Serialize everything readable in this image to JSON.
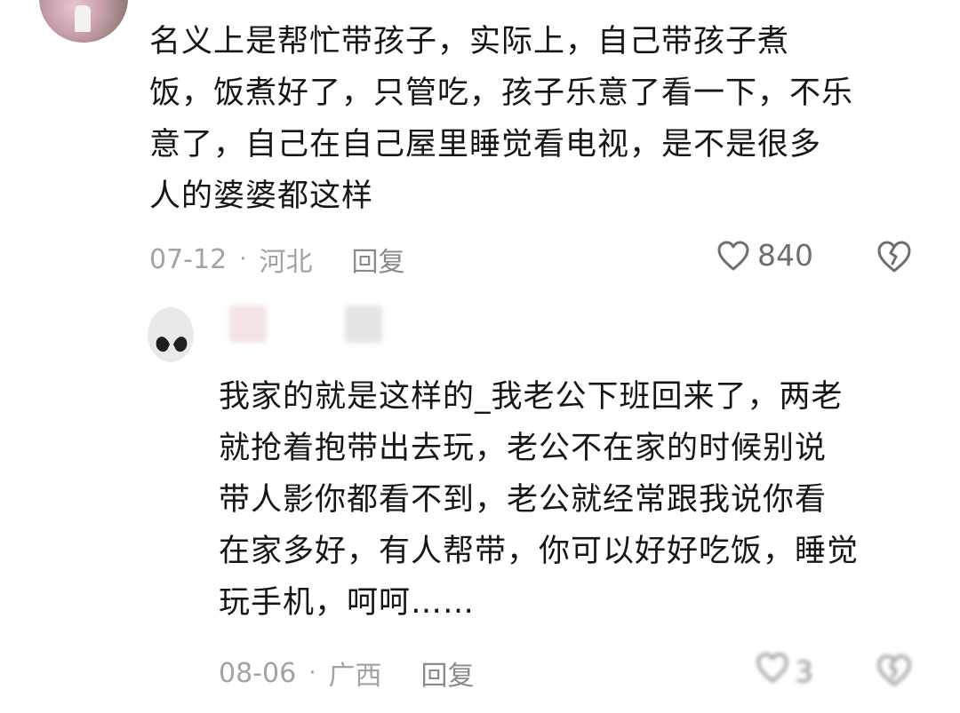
{
  "comment": {
    "text_lines": [
      "名义上是帮忙带孩子，实际上，自己带孩子煮",
      "饭，饭煮好了，只管吃，孩子乐意了看一下，不乐",
      "意了，自己在自己屋里睡觉看电视，是不是很多",
      "人的婆婆都这样"
    ],
    "date": "07-12",
    "separator": "·",
    "location": "河北",
    "reply_label": "回复",
    "like_count": "840",
    "like_icon": "heart-outline-icon",
    "dislike_icon": "broken-heart-icon"
  },
  "reply": {
    "text_lines": [
      "我家的就是这样的_我老公下班回来了，两老",
      "就抢着抱带出去玩，老公不在家的时候别说",
      "带人影你都看不到，老公就经常跟我说你看",
      "在家多好，有人帮带，你可以好好吃饭，睡觉",
      "玩手机，呵呵……"
    ],
    "date": "08-06",
    "separator": "·",
    "location": "广西",
    "reply_label": "回复",
    "like_count": "3",
    "like_icon": "heart-outline-icon",
    "dislike_icon": "broken-heart-icon"
  },
  "colors": {
    "text": "#161616",
    "meta": "#a3a3a3",
    "icon": "#6f6f6f"
  }
}
